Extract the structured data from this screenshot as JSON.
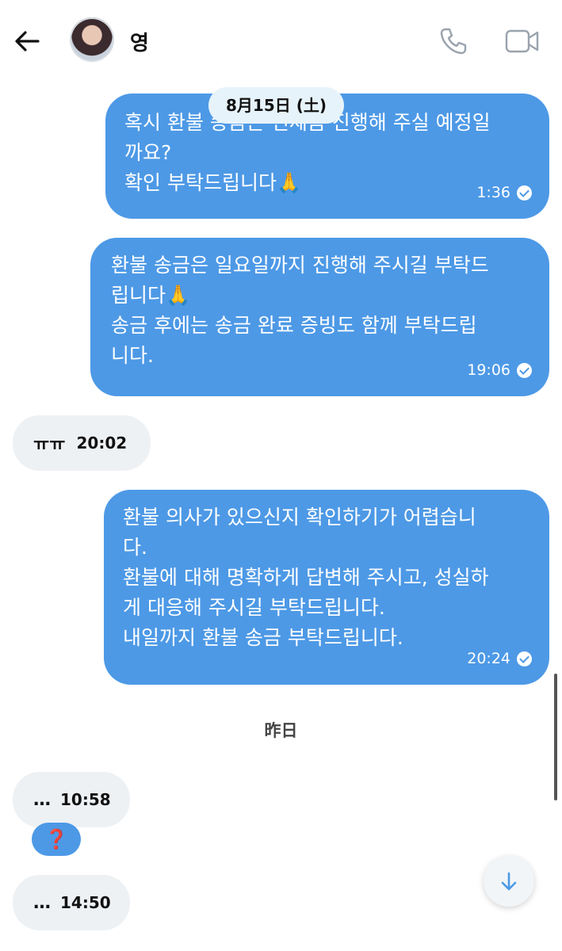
{
  "header": {
    "contact_name": "영",
    "icons": {
      "back": "arrow-left-icon",
      "call": "phone-icon",
      "video": "video-camera-icon"
    }
  },
  "date_pill": "8月15日 (土)",
  "messages": [
    {
      "direction": "out",
      "text": "혹시 환불 송금은 언제쯤 진행해 주실 예정일\n까요?\n확인 부탁드립니다🙏",
      "time": "1:36",
      "read": true
    },
    {
      "direction": "out",
      "text": "환불 송금은 일요일까지 진행해 주시길 부탁드\n립니다🙏\n송금 후에는 송금 완료 증빙도 함께 부탁드립\n니다.",
      "time": "19:06",
      "read": true
    },
    {
      "direction": "in",
      "text": "ㅠㅠ",
      "time": "20:02"
    },
    {
      "direction": "out",
      "text": "환불 의사가 있으신지 확인하기가 어렵습니\n다.\n환불에 대해 명확하게 답변해 주시고, 성실하\n게 대응해 주시길 부탁드립니다.\n내일까지 환불 송금 부탁드립니다.",
      "time": "20:24",
      "read": true
    },
    {
      "direction": "in",
      "text": "…",
      "time": "10:58",
      "reaction": "❓"
    },
    {
      "direction": "in",
      "text": "…",
      "time": "14:50"
    }
  ],
  "day_divider": "昨日",
  "colors": {
    "outgoing_bubble": "#4d99e6",
    "incoming_bubble": "#eef1f4",
    "date_pill": "#e7f3fb"
  }
}
